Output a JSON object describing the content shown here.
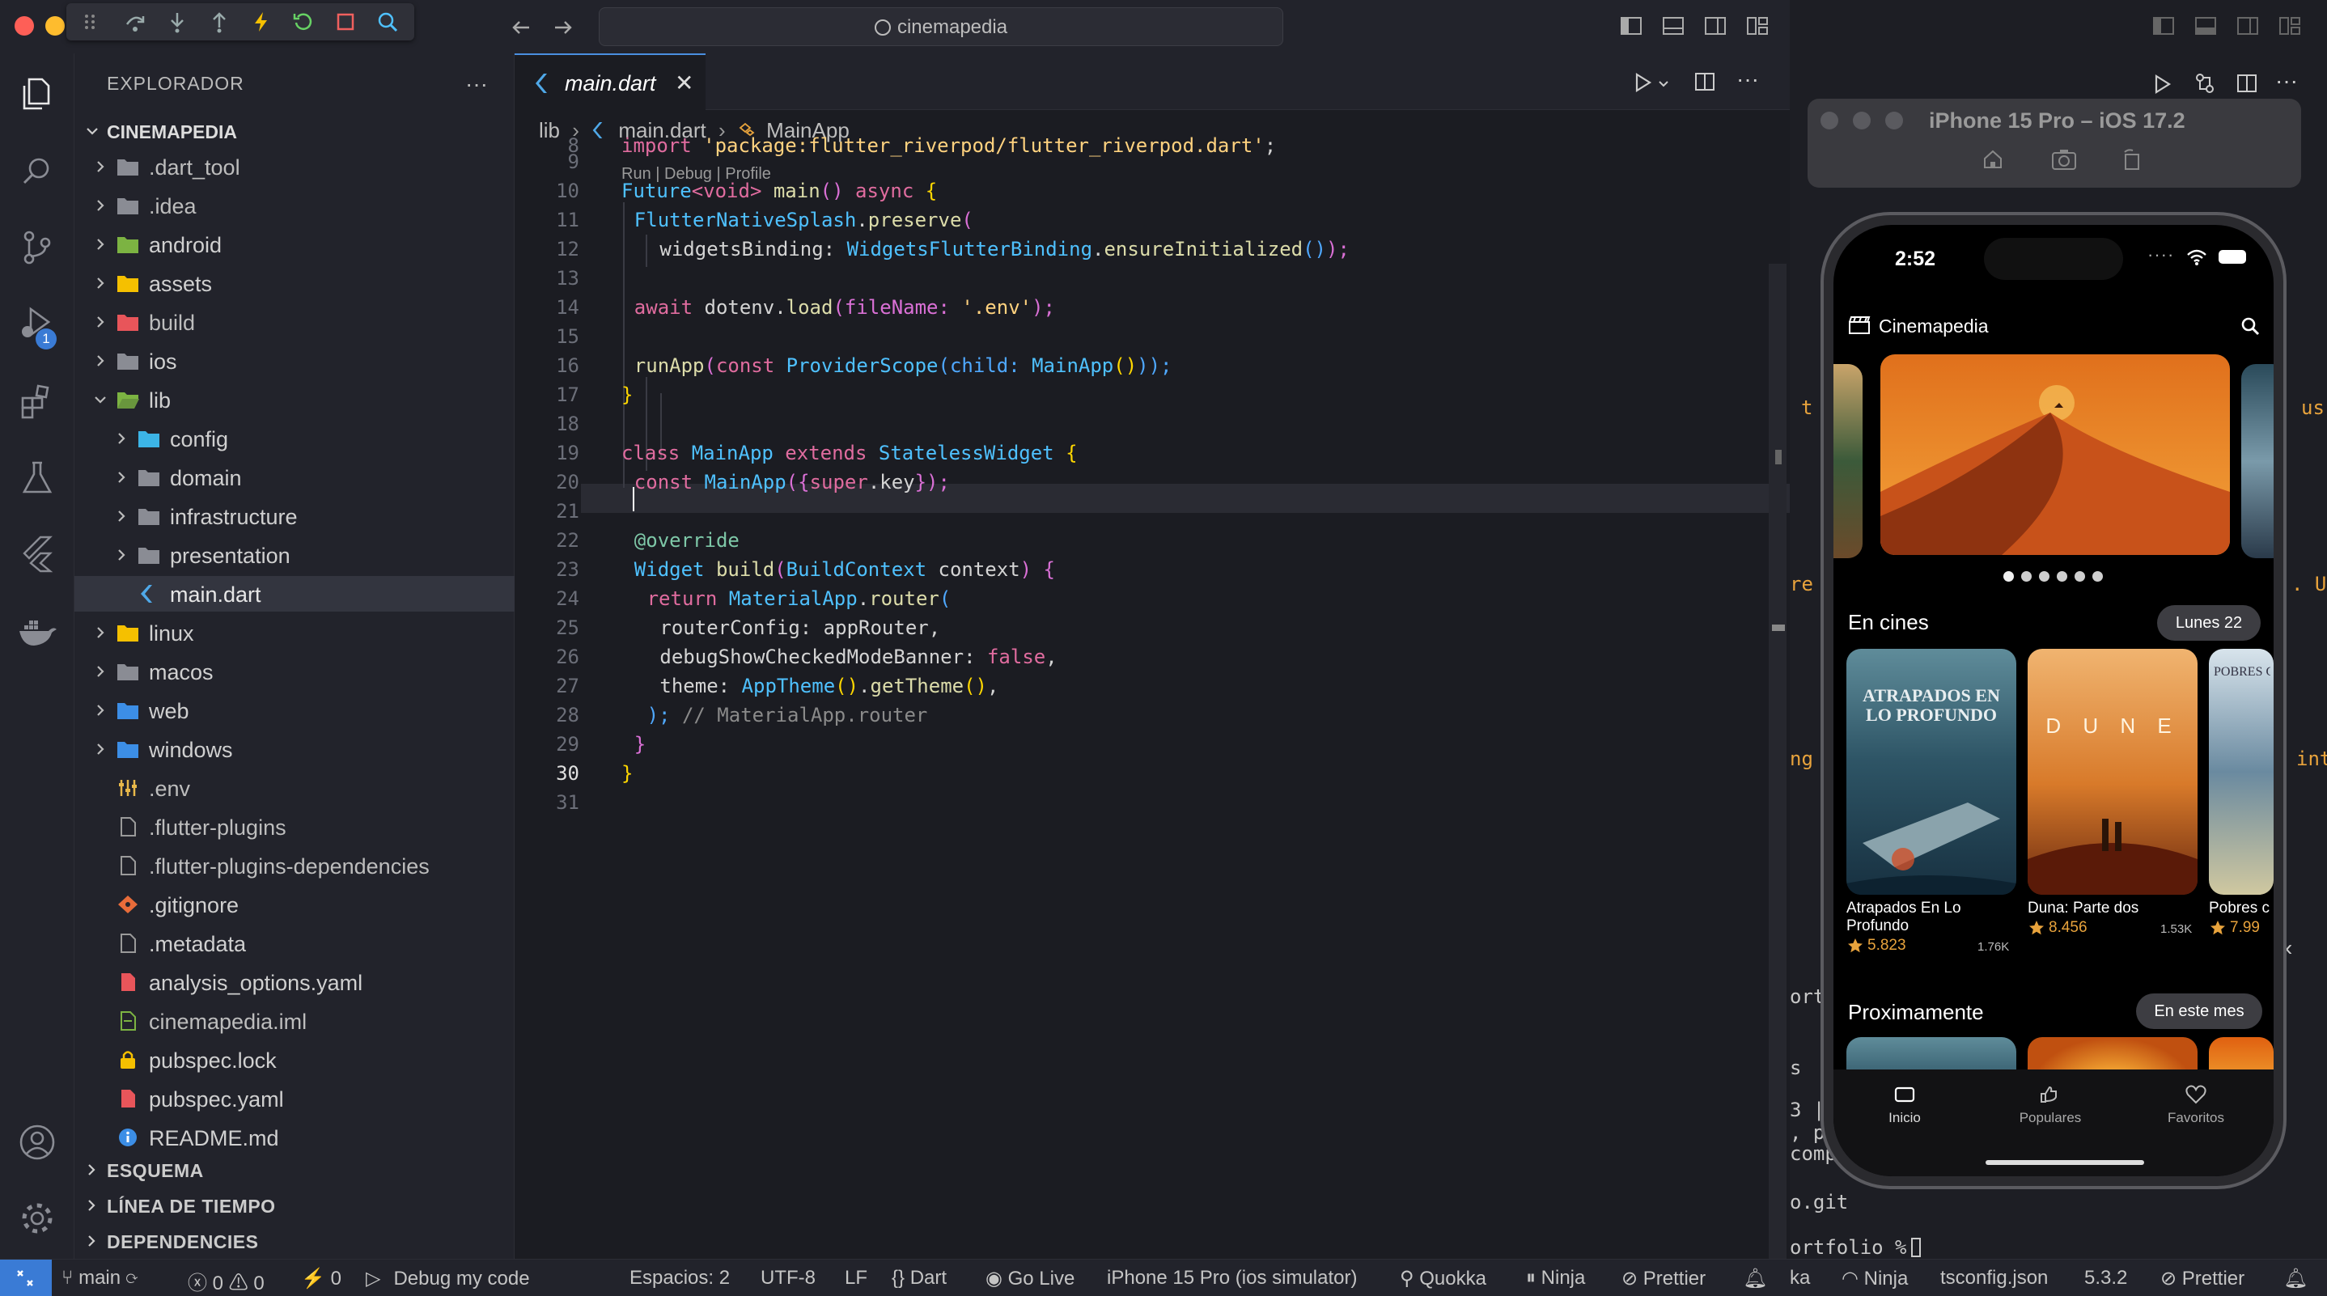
{
  "window": {
    "search_text": "cinemapedia"
  },
  "explorer": {
    "title": "EXPLORADOR",
    "more": "···",
    "root": "CINEMAPEDIA",
    "items": [
      {
        "name": ".dart_tool"
      },
      {
        "name": ".idea"
      },
      {
        "name": "android"
      },
      {
        "name": "assets"
      },
      {
        "name": "build"
      },
      {
        "name": "ios"
      },
      {
        "name": "lib"
      },
      {
        "name": "config"
      },
      {
        "name": "domain"
      },
      {
        "name": "infrastructure"
      },
      {
        "name": "presentation"
      },
      {
        "name": "main.dart"
      },
      {
        "name": "linux"
      },
      {
        "name": "macos"
      },
      {
        "name": "web"
      },
      {
        "name": "windows"
      },
      {
        "name": ".env"
      },
      {
        "name": ".flutter-plugins"
      },
      {
        "name": ".flutter-plugins-dependencies"
      },
      {
        "name": ".gitignore"
      },
      {
        "name": ".metadata"
      },
      {
        "name": "analysis_options.yaml"
      },
      {
        "name": "cinemapedia.iml"
      },
      {
        "name": "pubspec.lock"
      },
      {
        "name": "pubspec.yaml"
      },
      {
        "name": "README.md"
      }
    ],
    "sections": [
      "ESQUEMA",
      "LÍNEA DE TIEMPO",
      "DEPENDENCIES"
    ]
  },
  "editor": {
    "tab": "main.dart",
    "breadcrumb": [
      "lib",
      "main.dart",
      "MainApp"
    ],
    "codelens": "Run | Debug | Profile",
    "line_numbers": [
      "8",
      "9",
      "10",
      "11",
      "12",
      "13",
      "14",
      "15",
      "16",
      "17",
      "18",
      "19",
      "20",
      "21",
      "22",
      "23",
      "24",
      "25",
      "26",
      "27",
      "28",
      "29",
      "30",
      "31"
    ],
    "code": {
      "l8_kw": "import",
      "l8_str": "'package:flutter_riverpod/flutter_riverpod.dart'",
      "l8_end": ";",
      "l10_a": "Future",
      "l10_b": "<",
      "l10_c": "void",
      "l10_d": "> ",
      "l10_e": "main",
      "l10_f": "() ",
      "l10_g": "async",
      "l10_h": " {",
      "l11_a": "FlutterNativeSplash",
      "l11_b": ".",
      "l11_c": "preserve",
      "l11_d": "(",
      "l12_a": "widgetsBinding: ",
      "l12_b": "WidgetsFlutterBinding",
      "l12_c": ".",
      "l12_d": "ensureInitialized",
      "l12_e": "()",
      "l12_f": ");",
      "l14_a": "await ",
      "l14_b": "dotenv",
      "l14_c": ".",
      "l14_d": "load",
      "l14_e": "(fileName: ",
      "l14_f": "'.env'",
      "l14_g": ");",
      "l16_a": "runApp",
      "l16_b": "(",
      "l16_c": "const ",
      "l16_d": "ProviderScope",
      "l16_e": "(child: ",
      "l16_f": "MainApp",
      "l16_g": "()",
      "l16_h": "));",
      "l17": "}",
      "l19_a": "class ",
      "l19_b": "MainApp ",
      "l19_c": "extends ",
      "l19_d": "StatelessWidget ",
      "l19_e": "{",
      "l20_a": "const ",
      "l20_b": "MainApp",
      "l20_c": "({",
      "l20_d": "super",
      "l20_e": ".key",
      "l20_f": "});",
      "l22": "@override",
      "l23_a": "Widget ",
      "l23_b": "build",
      "l23_c": "(",
      "l23_d": "BuildContext ",
      "l23_e": "context",
      "l23_f": ") {",
      "l24_a": "return ",
      "l24_b": "MaterialApp",
      "l24_c": ".",
      "l24_d": "router",
      "l24_e": "(",
      "l25_a": "routerConfig",
      "l25_b": ": appRouter,",
      "l26_a": "debugShowCheckedModeBanner",
      "l26_b": ": ",
      "l26_c": "false",
      "l26_d": ",",
      "l27_a": "theme",
      "l27_b": ": ",
      "l27_c": "AppTheme",
      "l27_d": "()",
      "l27_e": ".",
      "l27_f": "getTheme",
      "l27_g": "()",
      "l27_h": ",",
      "l28_a": ");",
      "l28_b": " // MaterialApp.router",
      "l29": "}",
      "l30": "}"
    }
  },
  "right_panel": {
    "frag_t": "t",
    "frag_us": "us",
    "frag_re": "re",
    "frag_u": ". U",
    "frag_ng": "ng",
    "frag_int": "int",
    "frag_ort": "ort",
    "frag_s": "s",
    "frag_3": "3 |",
    "frag_p": ", p",
    "frag_comp": "comp",
    "frag_git": "o.git",
    "prompt": "ortfolio % "
  },
  "simulator": {
    "title": "iPhone 15 Pro – iOS 17.2",
    "time": "2:52",
    "app_title": "Cinemapedia",
    "section_cines": "En cines",
    "chip_cines": "Lunes 22",
    "movies": [
      {
        "title": "Atrapados En Lo Profundo",
        "poster_text": "ATRAPADOS EN LO PROFUNDO",
        "rating": "5.823",
        "votes": "1.76K"
      },
      {
        "title": "Duna: Parte dos",
        "poster_text": "D U N E",
        "rating": "8.456",
        "votes": "1.53K"
      },
      {
        "title": "Pobres c",
        "poster_text": "POBRES CRI",
        "rating": "7.99",
        "votes": ""
      }
    ],
    "section_prox": "Proximamente",
    "chip_prox": "En este mes",
    "nav": [
      "Inicio",
      "Populares",
      "Favoritos"
    ],
    "slide_dots": 6,
    "colors": {
      "accent": "#e8a33c",
      "star": "#e8a33c"
    }
  },
  "statusbar": {
    "branch": "main",
    "errors": "0",
    "warnings": "0",
    "ports": "0",
    "debug": "Debug my code",
    "spaces": "Espacios: 2",
    "encoding": "UTF-8",
    "eol": "LF",
    "language": "Dart",
    "golive": "Go Live",
    "device": "iPhone 15 Pro (ios simulator)",
    "quokka": "Quokka",
    "ninja": "Ninja",
    "prettier": "Prettier",
    "r_ka": "ka",
    "r_ninja": "Ninja",
    "r_tsconfig": "tsconfig.json",
    "r_version": "5.3.2",
    "r_prettier": "Prettier"
  }
}
